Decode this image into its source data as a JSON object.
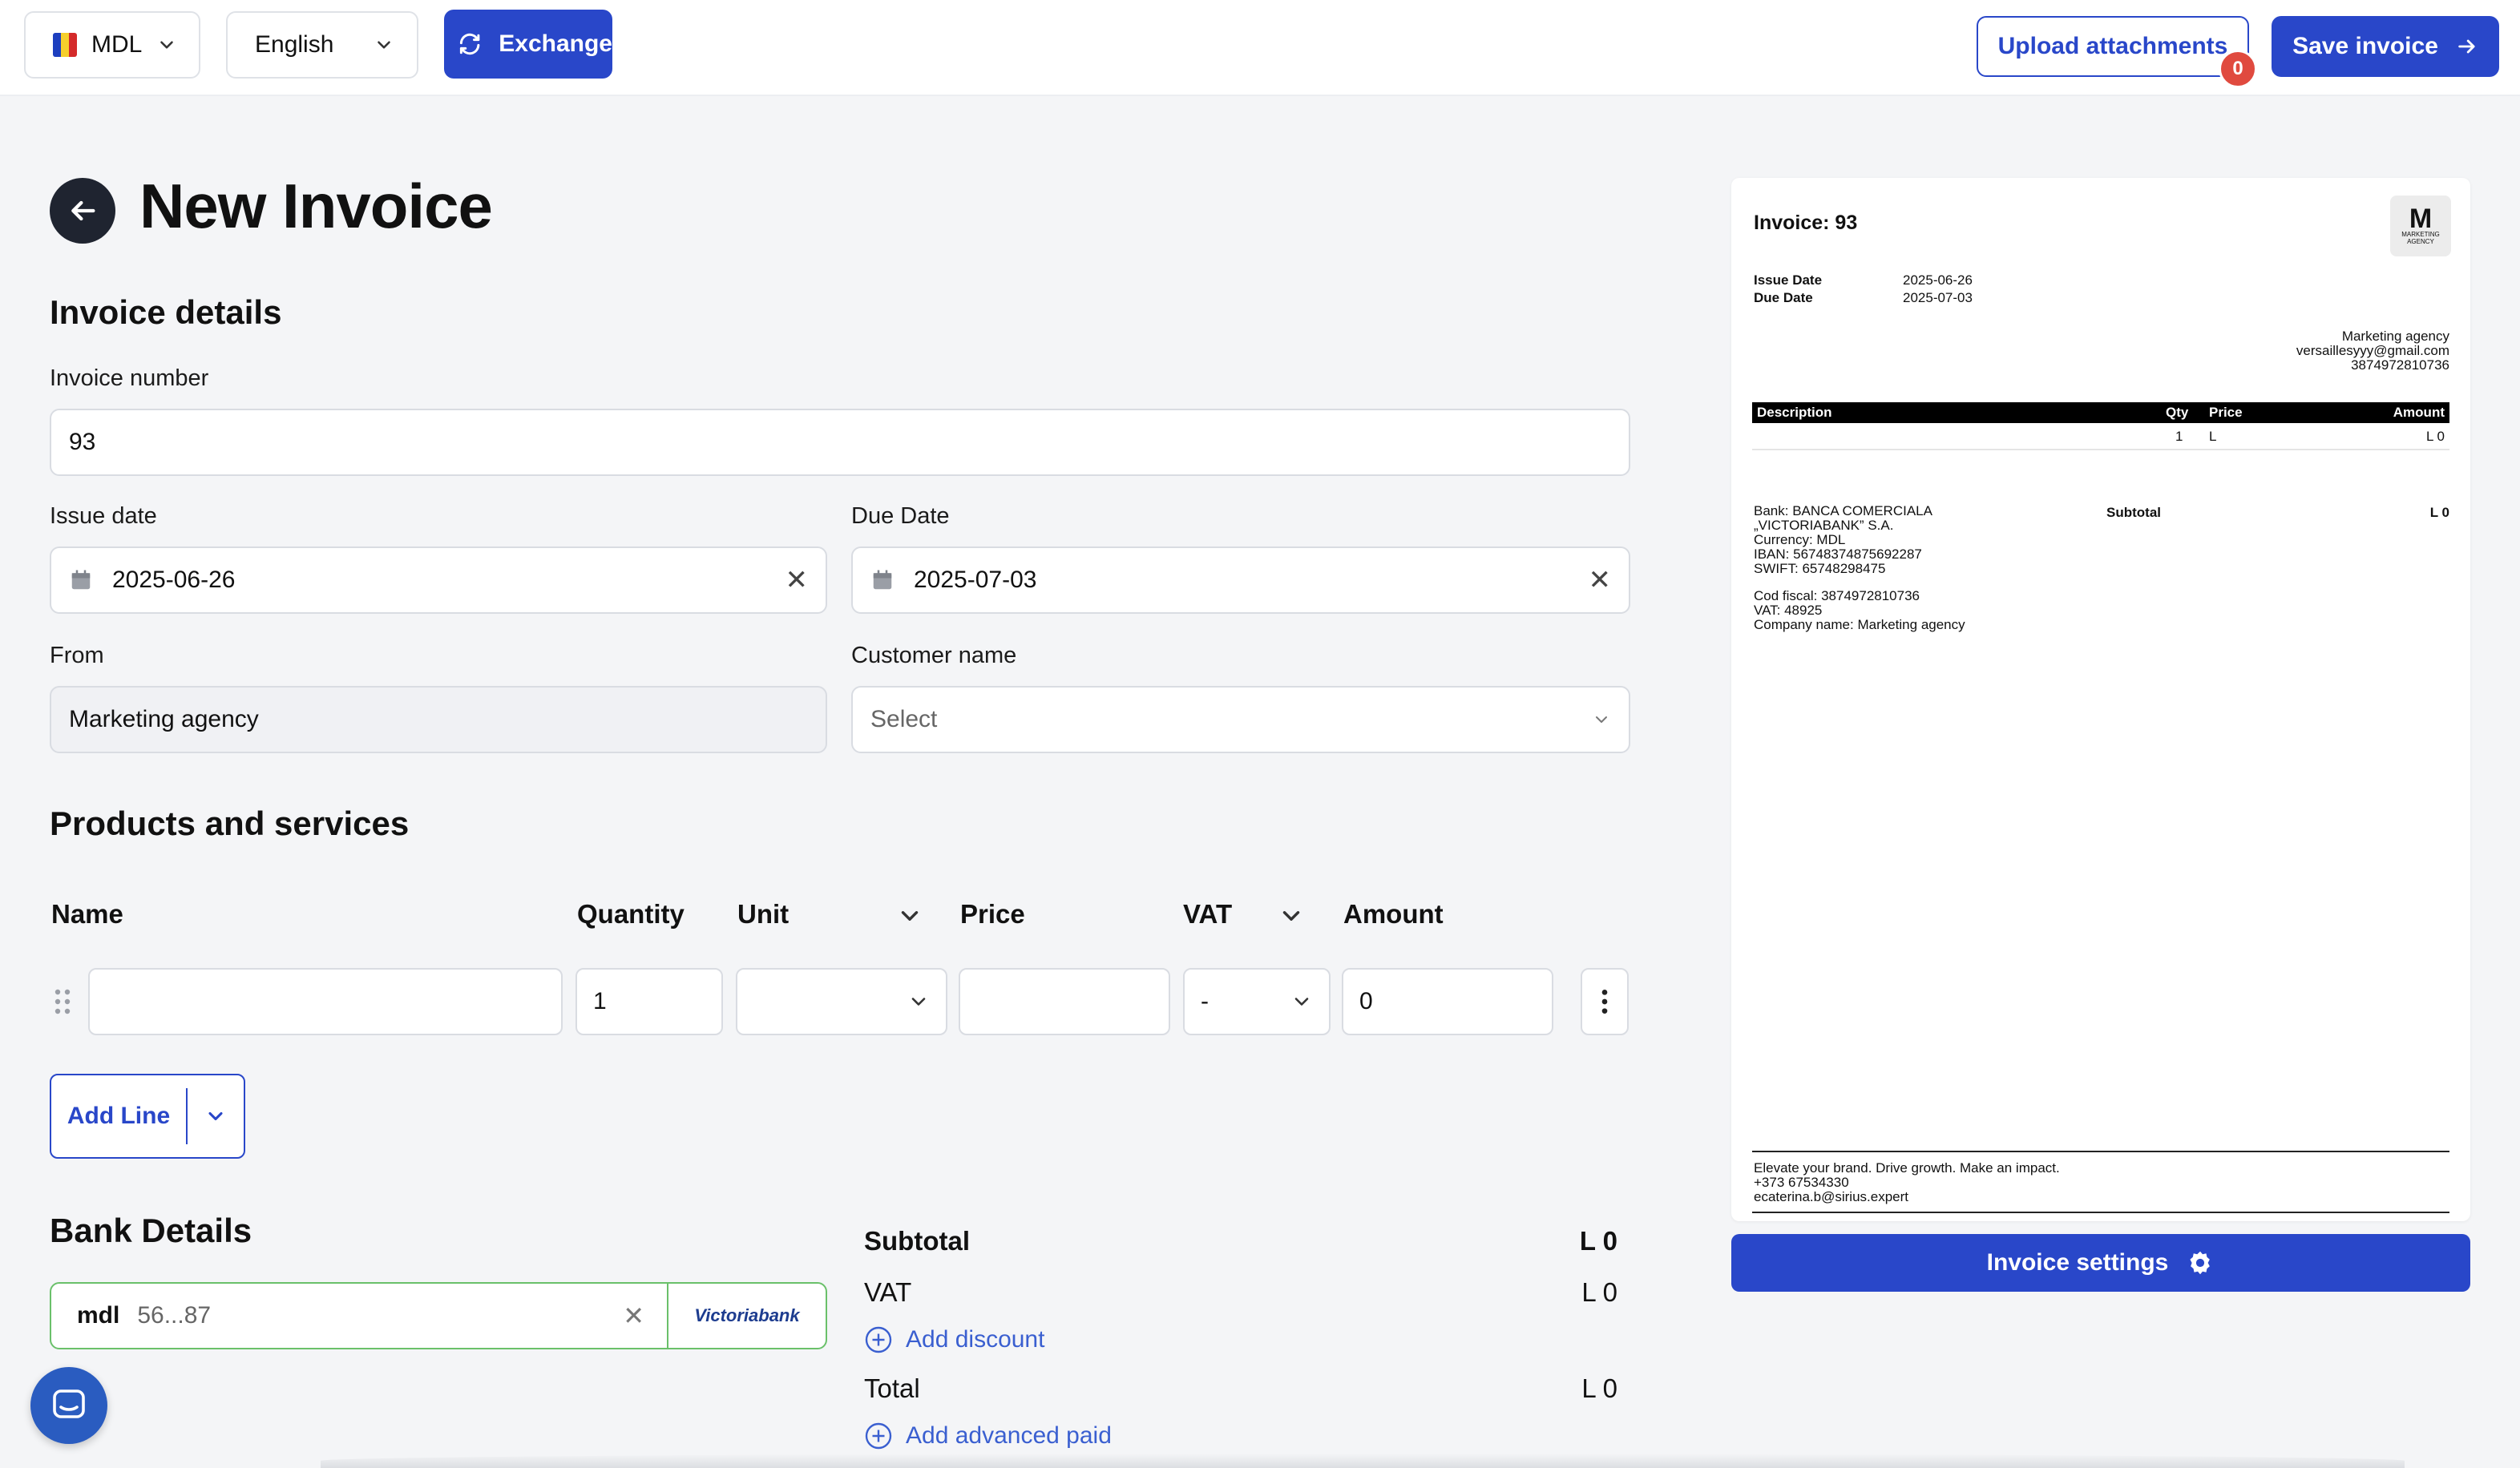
{
  "topbar": {
    "currency": "MDL",
    "language": "English",
    "exchange_label": "Exchange",
    "upload_label": "Upload attachments",
    "upload_count": "0",
    "save_label": "Save invoice"
  },
  "page": {
    "title": "New Invoice"
  },
  "invoice_details": {
    "heading": "Invoice details",
    "number_label": "Invoice number",
    "number_value": "93",
    "issue_label": "Issue date",
    "issue_value": "2025-06-26",
    "due_label": "Due Date",
    "due_value": "2025-07-03",
    "from_label": "From",
    "from_value": "Marketing agency",
    "customer_label": "Customer name",
    "customer_placeholder": "Select"
  },
  "products": {
    "heading": "Products and services",
    "columns": {
      "name": "Name",
      "quantity": "Quantity",
      "unit": "Unit",
      "price": "Price",
      "vat": "VAT",
      "amount": "Amount"
    },
    "row": {
      "name": "",
      "quantity": "1",
      "unit": "",
      "price": "",
      "vat": "-",
      "amount": "0"
    },
    "add_line_label": "Add Line"
  },
  "bank": {
    "heading": "Bank Details",
    "currency": "mdl",
    "account": "56...87",
    "bank_logo_text": "Victoriabank"
  },
  "totals": {
    "subtotal_label": "Subtotal",
    "subtotal_value": "L 0",
    "vat_label": "VAT",
    "vat_value": "L 0",
    "add_discount_label": "Add discount",
    "total_label": "Total",
    "total_value": "L 0",
    "add_advanced_paid_label": "Add advanced paid"
  },
  "preview": {
    "title": "Invoice: 93",
    "logo_letter": "M",
    "logo_sub": "MARKETING AGENCY",
    "issue_label": "Issue Date",
    "issue_value": "2025-06-26",
    "due_label": "Due Date",
    "due_value": "2025-07-03",
    "company_name": "Marketing agency",
    "company_email": "versaillesyyy@gmail.com",
    "company_code": "3874972810736",
    "table_headers": {
      "description": "Description",
      "qty": "Qty",
      "price": "Price",
      "amount": "Amount"
    },
    "table_row": {
      "qty": "1",
      "price": "L",
      "amount": "L 0"
    },
    "bank_lines": [
      "Bank: BANCA COMERCIALA",
      "„VICTORIABANK” S.A.",
      "Currency: MDL",
      "IBAN: 56748374875692287",
      "SWIFT: 65748298475"
    ],
    "fiscal_lines": [
      "Cod fiscal: 3874972810736",
      "VAT: 48925",
      "Company name: Marketing agency"
    ],
    "subtotal_label": "Subtotal",
    "subtotal_value": "L 0",
    "footer_lines": [
      "Elevate your brand. Drive growth. Make an impact.",
      "+373 67534330",
      "ecaterina.b@sirius.expert"
    ],
    "settings_label": "Invoice settings"
  },
  "colors": {
    "primary": "#2947c9",
    "badge": "#e04a3f",
    "bank_border": "#6ac06a",
    "link": "#3a5fd0"
  }
}
